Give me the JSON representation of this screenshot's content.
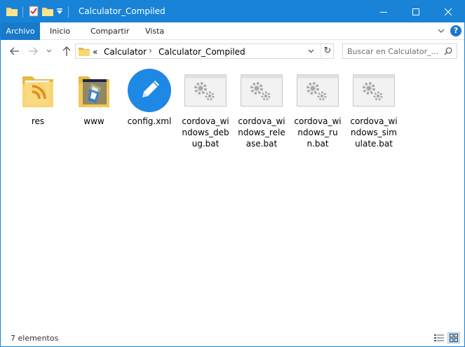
{
  "window": {
    "title": "Calculator_Compiled",
    "controls": {
      "minimize": "—",
      "maximize": "☐",
      "close": "✕"
    }
  },
  "ribbon": {
    "tabs": [
      "Archivo",
      "Inicio",
      "Compartir",
      "Vista"
    ],
    "collapse_icon": "chevron-down-icon",
    "help": "?"
  },
  "navigation": {
    "back": "←",
    "forward": "→",
    "recent": "⌄",
    "up": "↑",
    "breadcrumb_prefix": "«",
    "breadcrumb": [
      "Calculator",
      "Calculator_Compiled"
    ],
    "separator": "›",
    "refresh": "↻",
    "search_placeholder": "Buscar en Calculator_..."
  },
  "items": [
    {
      "name": "res",
      "icon": "folder-res-icon"
    },
    {
      "name": "www",
      "icon": "folder-www-icon"
    },
    {
      "name": "config.xml",
      "icon": "xml-editor-icon"
    },
    {
      "name": "cordova_windows_debug.bat",
      "icon": "batch-file-icon"
    },
    {
      "name": "cordova_windows_release.bat",
      "icon": "batch-file-icon"
    },
    {
      "name": "cordova_windows_run.bat",
      "icon": "batch-file-icon"
    },
    {
      "name": "cordova_windows_simulate.bat",
      "icon": "batch-file-icon"
    }
  ],
  "status": {
    "count": "7 elementos"
  },
  "colors": {
    "accent": "#1883d7",
    "file_tab": "#1979ca",
    "folder": "#f8d775",
    "xml_badge": "#1e88e5"
  }
}
